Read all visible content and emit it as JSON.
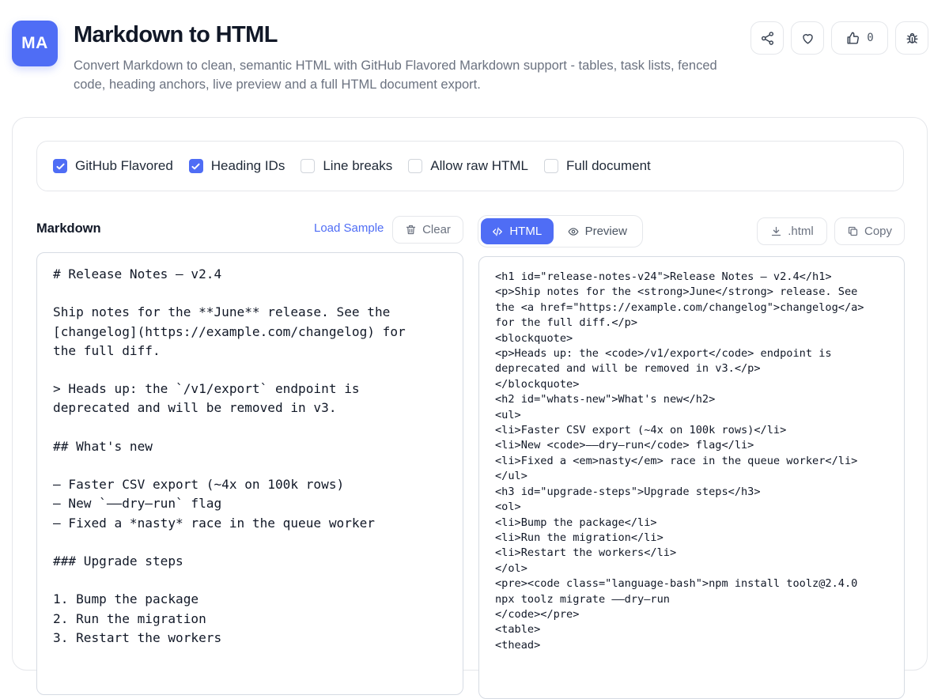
{
  "header": {
    "logo_text": "MA",
    "title": "Markdown to HTML",
    "description": "Convert Markdown to clean, semantic HTML with GitHub Flavored Markdown support - tables, task lists, fenced code, heading anchors, live preview and a full HTML document export.",
    "like_count": "0"
  },
  "options": [
    {
      "label": "GitHub Flavored",
      "checked": true
    },
    {
      "label": "Heading IDs",
      "checked": true
    },
    {
      "label": "Line breaks",
      "checked": false
    },
    {
      "label": "Allow raw HTML",
      "checked": false
    },
    {
      "label": "Full document",
      "checked": false
    }
  ],
  "input_pane": {
    "label": "Markdown",
    "load_sample_label": "Load Sample",
    "clear_label": "Clear",
    "content": "# Release Notes – v2.4\n\nShip notes for the **June** release. See the\n[changelog](https://example.com/changelog) for\nthe full diff.\n\n> Heads up: the `/v1/export` endpoint is\ndeprecated and will be removed in v3.\n\n## What's new\n\n– Faster CSV export (~4x on 100k rows)\n– New `––dry–run` flag\n– Fixed a *nasty* race in the queue worker\n\n### Upgrade steps\n\n1. Bump the package\n2. Run the migration\n3. Restart the workers"
  },
  "output_pane": {
    "tabs": [
      {
        "label": "HTML",
        "active": true
      },
      {
        "label": "Preview",
        "active": false
      }
    ],
    "download_label": ".html",
    "copy_label": "Copy",
    "content": "<h1 id=\"release-notes-v24\">Release Notes – v2.4</h1>\n<p>Ship notes for the <strong>June</strong> release. See\nthe <a href=\"https://example.com/changelog\">changelog</a>\nfor the full diff.</p>\n<blockquote>\n<p>Heads up: the <code>/v1/export</code> endpoint is\ndeprecated and will be removed in v3.</p>\n</blockquote>\n<h2 id=\"whats-new\">What's new</h2>\n<ul>\n<li>Faster CSV export (~4x on 100k rows)</li>\n<li>New <code>––dry–run</code> flag</li>\n<li>Fixed a <em>nasty</em> race in the queue worker</li>\n</ul>\n<h3 id=\"upgrade-steps\">Upgrade steps</h3>\n<ol>\n<li>Bump the package</li>\n<li>Run the migration</li>\n<li>Restart the workers</li>\n</ol>\n<pre><code class=\"language-bash\">npm install toolz@2.4.0\nnpx toolz migrate ––dry–run\n</code></pre>\n<table>\n<thead>"
  },
  "colors": {
    "accent": "#4f6df5",
    "border": "#e5e7eb",
    "muted_text": "#6b7280"
  }
}
